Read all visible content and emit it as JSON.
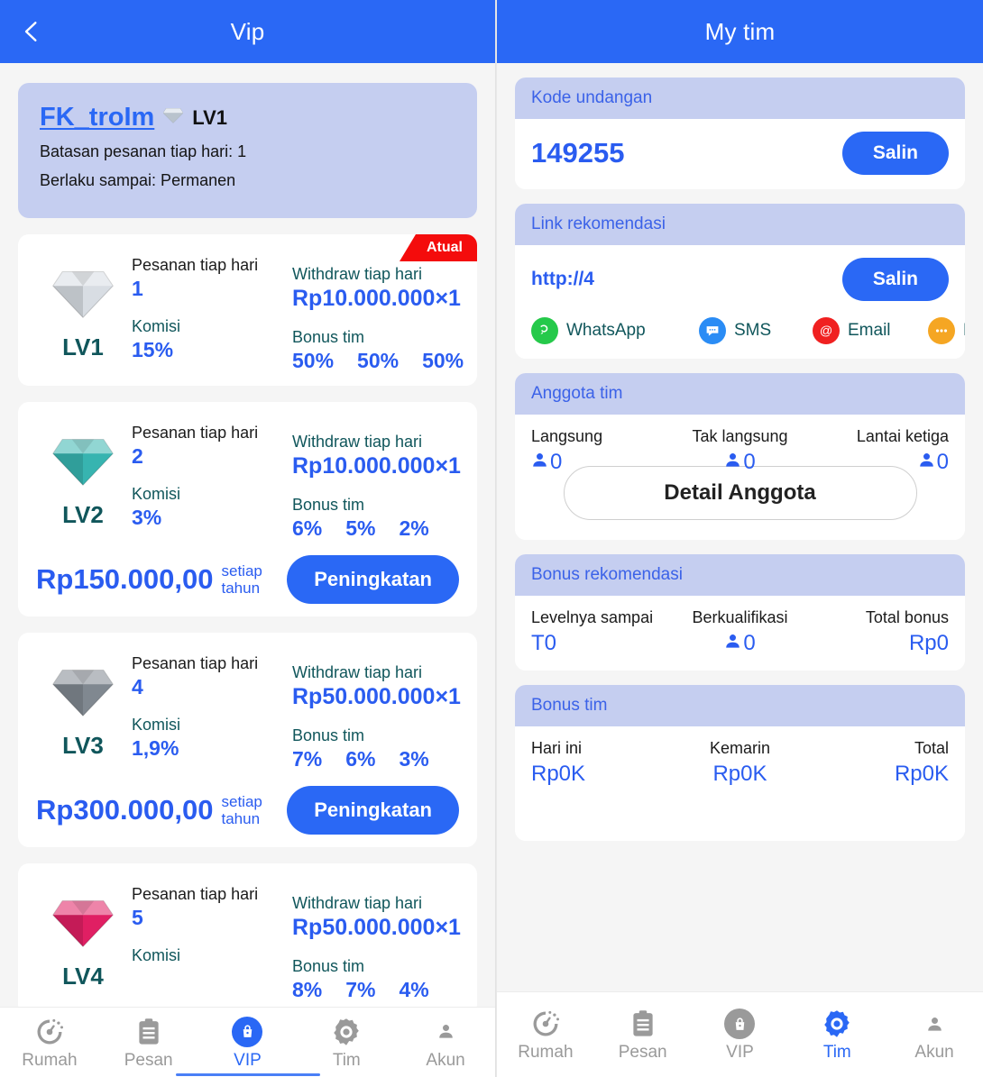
{
  "colors": {
    "brand_blue": "#2a68f5",
    "value_blue": "#2a5cf0",
    "lavender": "#c5cef0",
    "badge_red": "#f40c0c",
    "lv_teal": "#10565b",
    "muted_grey": "#9a9a9a"
  },
  "vip_panel": {
    "appbar": {
      "title": "Vip",
      "back_icon": "chevron-left-icon"
    },
    "profile": {
      "name": "FK_troIm",
      "level": "LV1",
      "gem_icon": "diamond-icon",
      "line1": "Batasan pesanan tiap hari: 1",
      "line2": "Berlaku sampai: Permanen"
    },
    "labels": {
      "orders_per_day": "Pesanan tiap hari",
      "commission": "Komisi",
      "withdraw_per_day": "Withdraw tiap hari",
      "team_bonus": "Bonus tim",
      "per_year": "setiap tahun",
      "upgrade_button": "Peningkatan",
      "current_badge": "Atual"
    },
    "levels": [
      {
        "lv": "LV1",
        "gem_color": "#d8dde3",
        "gem_icon": "diamond-icon",
        "orders": "1",
        "commission": "15%",
        "withdraw": "Rp10.000.000×1",
        "bonus": [
          "50%",
          "50%",
          "50%"
        ],
        "is_current": true,
        "price": "",
        "show_upgrade": false
      },
      {
        "lv": "LV2",
        "gem_color": "#37b4b0",
        "gem_icon": "diamond-icon",
        "orders": "2",
        "commission": "3%",
        "withdraw": "Rp10.000.000×1",
        "bonus": [
          "6%",
          "5%",
          "2%"
        ],
        "is_current": false,
        "price": "Rp150.000,00",
        "show_upgrade": true
      },
      {
        "lv": "LV3",
        "gem_color": "#808890",
        "gem_icon": "diamond-icon",
        "orders": "4",
        "commission": "1,9%",
        "withdraw": "Rp50.000.000×1",
        "bonus": [
          "7%",
          "6%",
          "3%"
        ],
        "is_current": false,
        "price": "Rp300.000,00",
        "show_upgrade": true
      },
      {
        "lv": "LV4",
        "gem_color": "#e01f63",
        "gem_icon": "diamond-icon",
        "orders": "5",
        "commission": "",
        "withdraw": "Rp50.000.000×1",
        "bonus": [
          "8%",
          "7%",
          "4%"
        ],
        "is_current": false,
        "price": "",
        "show_upgrade": false
      }
    ],
    "tabbar": [
      {
        "label": "Rumah",
        "icon": "speedometer-icon",
        "active": false
      },
      {
        "label": "Pesan",
        "icon": "clipboard-icon",
        "active": false
      },
      {
        "label": "VIP",
        "icon": "lock-bag-icon",
        "active": true
      },
      {
        "label": "Tim",
        "icon": "gear-icon",
        "active": false
      },
      {
        "label": "Akun",
        "icon": "person-icon",
        "active": false
      }
    ]
  },
  "tim_panel": {
    "appbar": {
      "title": "My tim"
    },
    "invite": {
      "header": "Kode undangan",
      "code": "149255",
      "copy_label": "Salin"
    },
    "link": {
      "header": "Link rekomendasi",
      "url": "http://4",
      "copy_label": "Salin",
      "share": [
        {
          "label": "WhatsApp",
          "icon": "whatsapp-icon",
          "color": "#25c94a"
        },
        {
          "label": "SMS",
          "icon": "sms-bubble-icon",
          "color": "#2a8cf5"
        },
        {
          "label": "Email",
          "icon": "at-sign-icon",
          "color": "#f02020"
        },
        {
          "label": "Mais",
          "icon": "more-dots-icon",
          "color": "#f5a623"
        }
      ]
    },
    "members": {
      "header": "Anggota tim",
      "cols": [
        {
          "label": "Langsung",
          "value": "0",
          "icon": "person-icon"
        },
        {
          "label": "Tak langsung",
          "value": "0",
          "icon": "person-icon"
        },
        {
          "label": "Lantai ketiga",
          "value": "0",
          "icon": "person-icon"
        }
      ],
      "detail_button": "Detail Anggota"
    },
    "bonus_rec": {
      "header": "Bonus rekomendasi",
      "cols": [
        {
          "label": "Levelnya sampai",
          "value": "T0",
          "icon": ""
        },
        {
          "label": "Berkualifikasi",
          "value": "0",
          "icon": "person-icon"
        },
        {
          "label": "Total bonus",
          "value": "Rp0",
          "icon": ""
        }
      ]
    },
    "bonus_team": {
      "header": "Bonus tim",
      "cols": [
        {
          "label": "Hari ini",
          "value": "Rp0K",
          "icon": ""
        },
        {
          "label": "Kemarin",
          "value": "Rp0K",
          "icon": ""
        },
        {
          "label": "Total",
          "value": "Rp0K",
          "icon": ""
        }
      ]
    },
    "tabbar": [
      {
        "label": "Rumah",
        "icon": "speedometer-icon",
        "active": false
      },
      {
        "label": "Pesan",
        "icon": "clipboard-icon",
        "active": false
      },
      {
        "label": "VIP",
        "icon": "lock-bag-icon",
        "active": false
      },
      {
        "label": "Tim",
        "icon": "gear-icon",
        "active": true
      },
      {
        "label": "Akun",
        "icon": "person-icon",
        "active": false
      }
    ]
  }
}
